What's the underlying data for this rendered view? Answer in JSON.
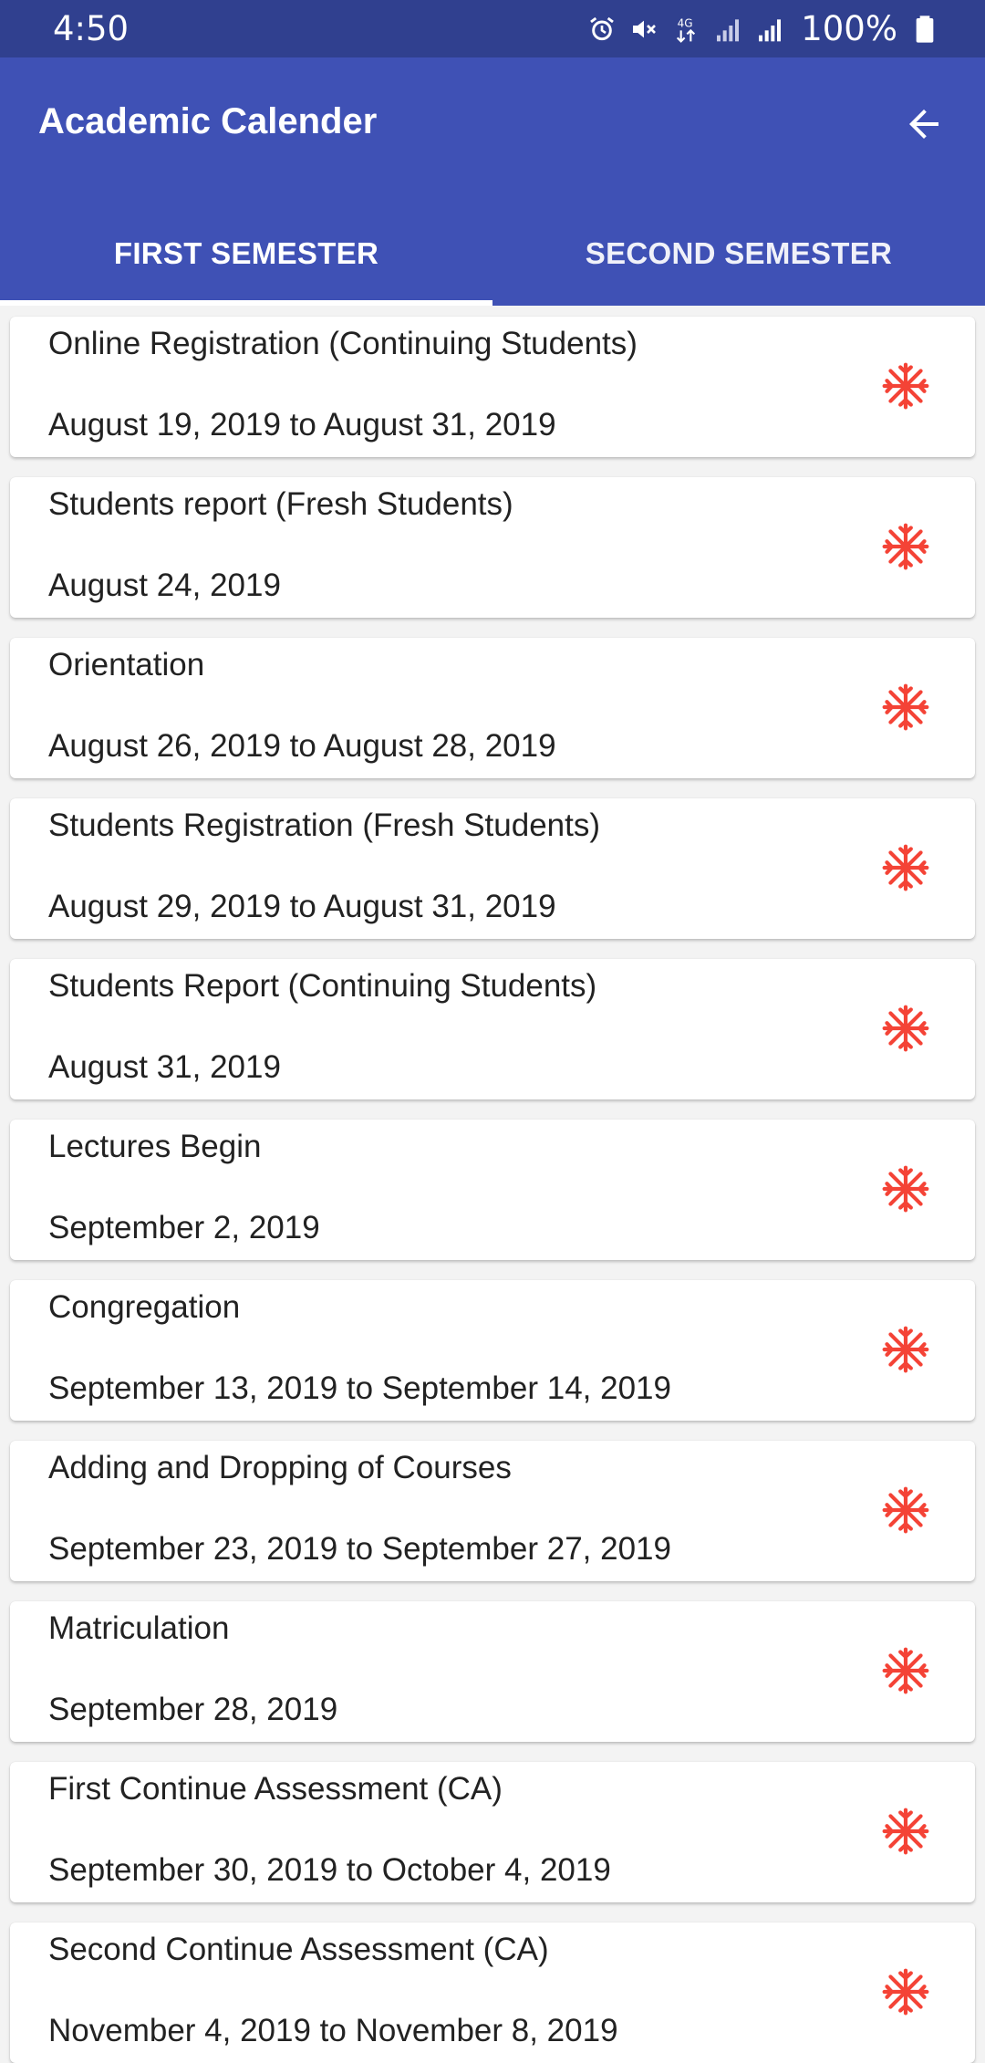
{
  "status_bar": {
    "time": "4:50",
    "battery": "100%",
    "icons": [
      "alarm-icon",
      "mute-icon",
      "4g-data-icon",
      "signal-icon",
      "signal-icon",
      "battery-icon"
    ]
  },
  "app_bar": {
    "title": "Academic Calender",
    "back_icon": "arrow-back-icon",
    "color": "#3f51b5"
  },
  "tabs": [
    {
      "label": "FIRST SEMESTER",
      "selected": true
    },
    {
      "label": "SECOND SEMESTER",
      "selected": false
    }
  ],
  "events": [
    {
      "title": "Online Registration (Continuing Students)",
      "date": "August 19, 2019 to August 31, 2019"
    },
    {
      "title": "Students report (Fresh Students)",
      "date": "August 24, 2019"
    },
    {
      "title": "Orientation",
      "date": "August 26, 2019 to August 28, 2019"
    },
    {
      "title": "Students Registration (Fresh Students)",
      "date": "August 29, 2019 to August 31, 2019"
    },
    {
      "title": "Students Report (Continuing Students)",
      "date": "August 31, 2019"
    },
    {
      "title": "Lectures Begin",
      "date": "September 2, 2019"
    },
    {
      "title": "Congregation",
      "date": "September 13, 2019 to September 14, 2019"
    },
    {
      "title": "Adding and Dropping of Courses",
      "date": "September 23, 2019 to September 27, 2019"
    },
    {
      "title": "Matriculation",
      "date": "September 28, 2019"
    },
    {
      "title": "First Continue Assessment (CA)",
      "date": "September 30, 2019 to October 4, 2019"
    },
    {
      "title": "Second Continue Assessment (CA)",
      "date": "November 4, 2019 to November 8, 2019"
    }
  ],
  "event_icon": "asterisk-icon",
  "event_icon_color": "#f44336"
}
